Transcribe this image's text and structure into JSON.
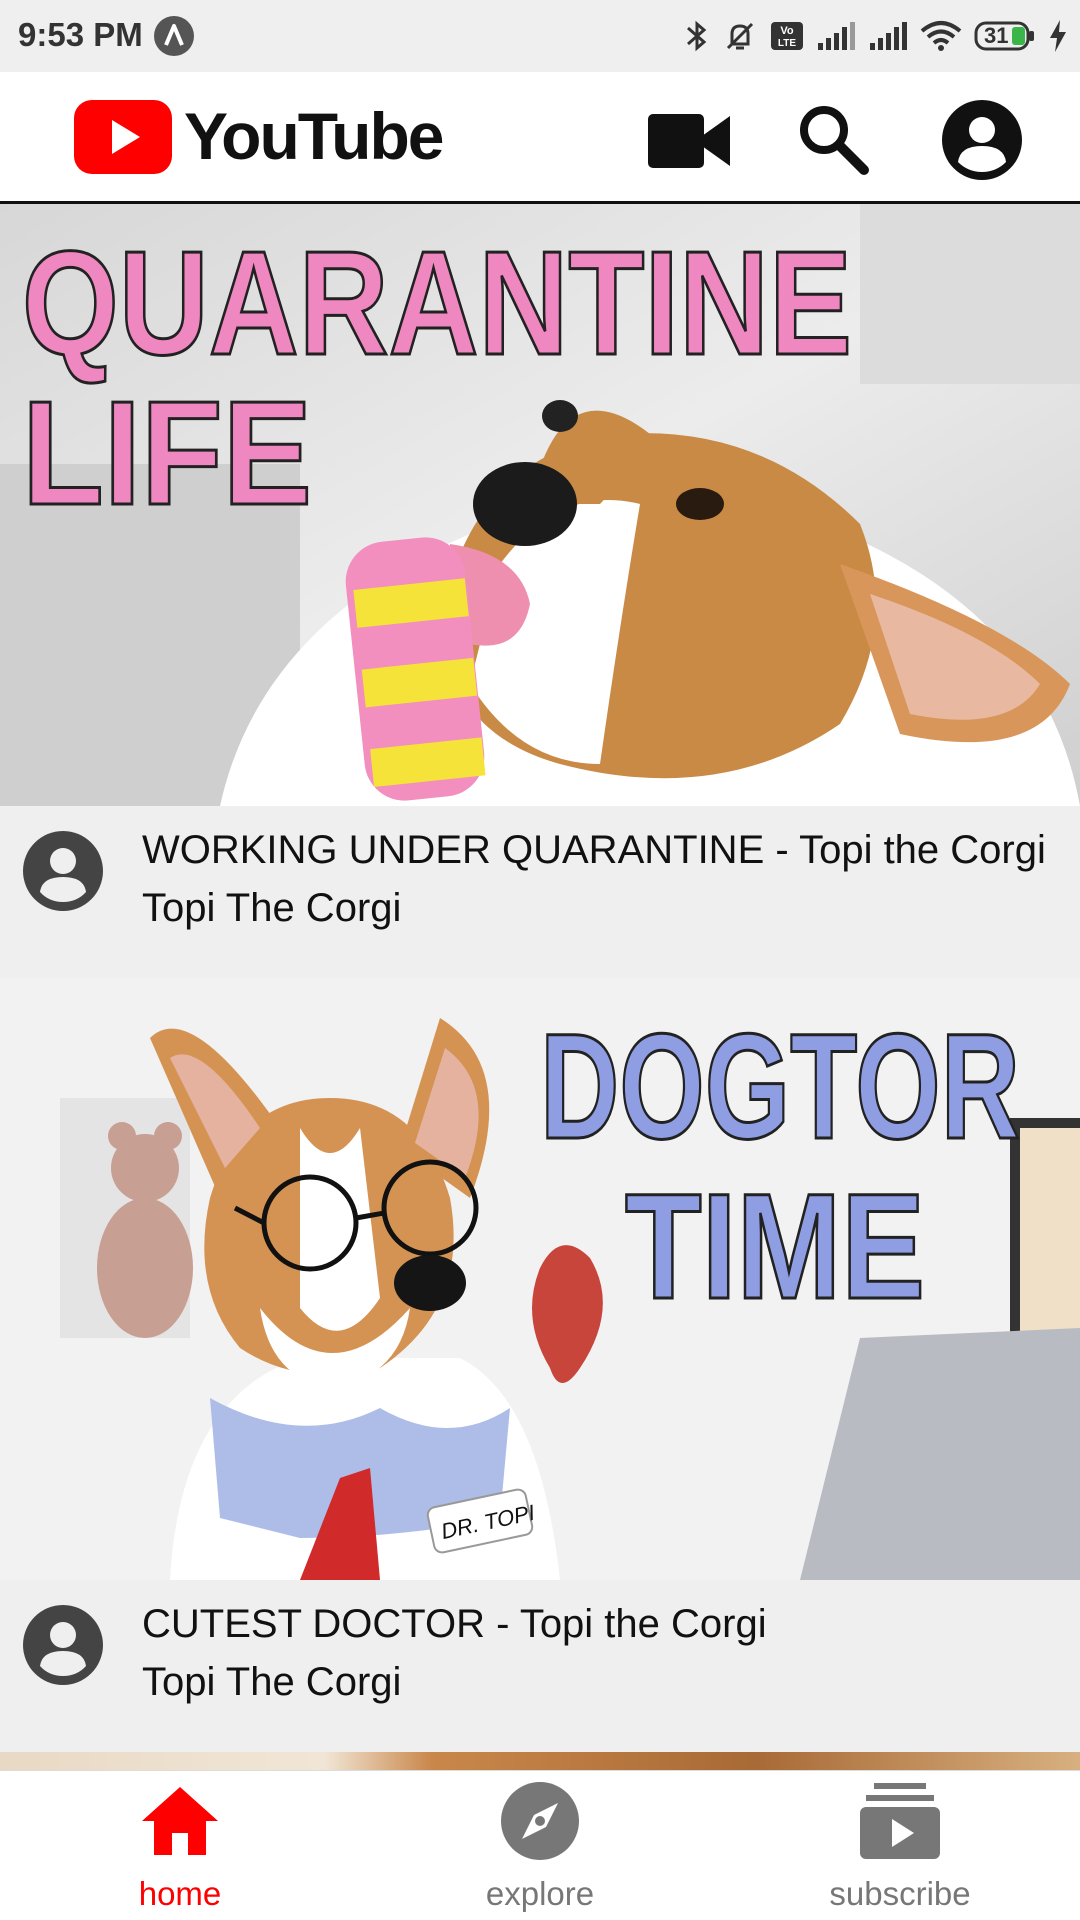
{
  "status_bar": {
    "time": "9:53 PM",
    "battery_level": "31",
    "icons": [
      "assistant-a-icon",
      "bluetooth-icon",
      "mute-icon",
      "volte-icon",
      "signal-icon",
      "signal-icon",
      "wifi-icon",
      "battery-icon",
      "charging-icon"
    ]
  },
  "app_bar": {
    "title": "YouTube",
    "brand_color": "#ff0000",
    "actions": [
      "video-camera-icon",
      "search-icon",
      "account-icon"
    ]
  },
  "feed": {
    "videos": [
      {
        "title": "WORKING UNDER QUARANTINE - Topi the Corgi",
        "channel": "Topi The Corgi",
        "thumbnail_text": [
          "QUARANTINE",
          "LIFE"
        ]
      },
      {
        "title": "CUTEST DOCTOR - Topi the Corgi",
        "channel": "Topi The Corgi",
        "thumbnail_text": [
          "DOGTOR",
          "TIME"
        ],
        "thumbnail_badge": "DR. TOPI"
      }
    ]
  },
  "bottom_nav": {
    "active_color": "#ff0000",
    "inactive_color": "#777777",
    "items": [
      {
        "label": "home",
        "icon": "home-icon",
        "active": true
      },
      {
        "label": "explore",
        "icon": "compass-icon",
        "active": false
      },
      {
        "label": "subscribe",
        "icon": "subscriptions-icon",
        "active": false
      }
    ]
  }
}
